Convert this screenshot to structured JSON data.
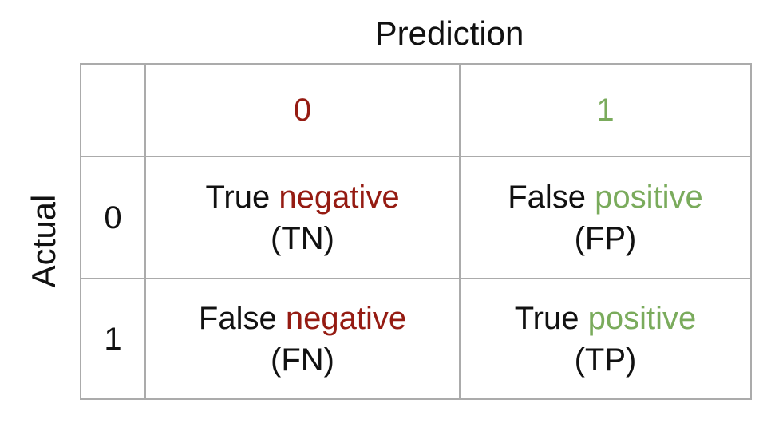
{
  "axis_titles": {
    "columns": "Prediction",
    "rows": "Actual"
  },
  "colors": {
    "negative": "#951b12",
    "positive": "#7aab5c",
    "grid": "#ababab"
  },
  "column_headers": [
    "0",
    "1"
  ],
  "row_headers": [
    "0",
    "1"
  ],
  "cells": [
    [
      {
        "word1": "True",
        "word2": "negative",
        "abbr": "(TN)"
      },
      {
        "word1": "False",
        "word2": "positive",
        "abbr": "(FP)"
      }
    ],
    [
      {
        "word1": "False",
        "word2": "negative",
        "abbr": "(FN)"
      },
      {
        "word1": "True",
        "word2": "positive",
        "abbr": "(TP)"
      }
    ]
  ]
}
